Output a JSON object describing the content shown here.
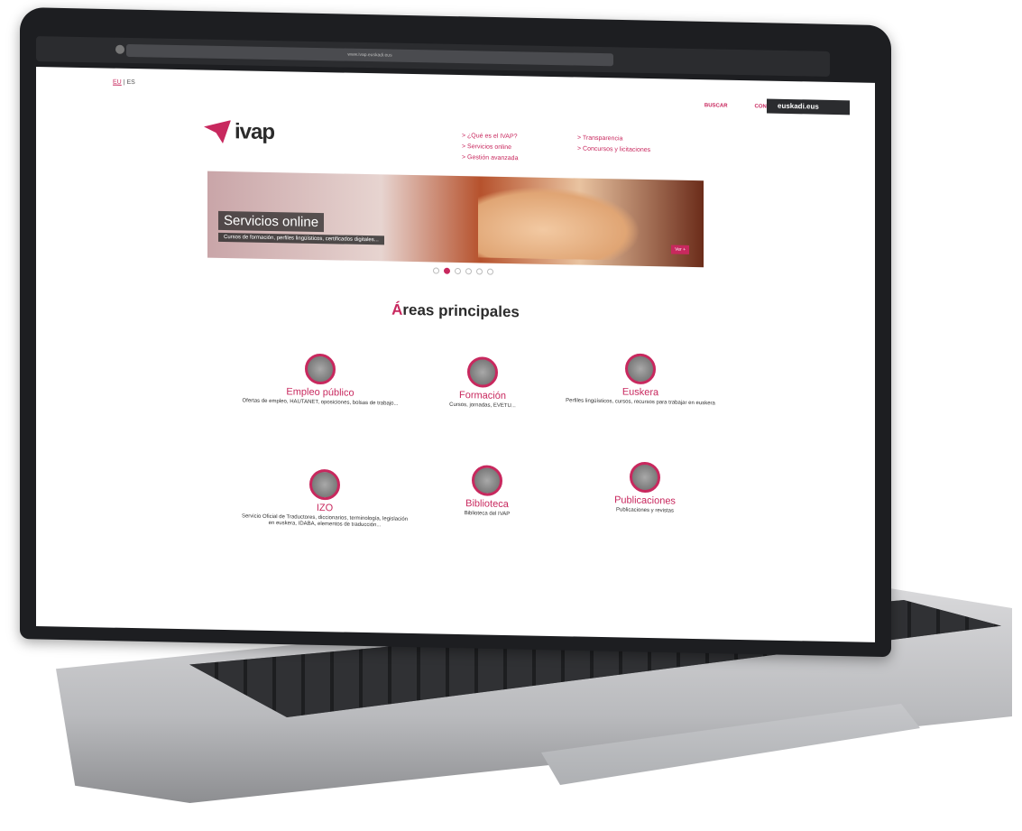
{
  "browser": {
    "url": "www.ivap.euskadi.eus"
  },
  "header": {
    "lang_eu": "EU",
    "lang_sep": "|",
    "lang_es": "ES",
    "nav_search": "BUSCAR",
    "nav_contact": "CONTACTO",
    "euskadi_label": "euskadi.eus"
  },
  "logo": {
    "text": "ivap"
  },
  "links": {
    "col1": [
      "> ¿Qué es el IVAP?",
      "> Servicios online",
      "> Gestión avanzada"
    ],
    "col2": [
      "> Transparencia",
      "> Concursos y licitaciones"
    ]
  },
  "hero": {
    "title": "Servicios online",
    "subtitle": "Cursos de formación, perfiles lingüísticos, certificados digitales...",
    "more": "Ver +"
  },
  "section": {
    "first_letter": "Á",
    "rest": "reas principales"
  },
  "areas": [
    {
      "name": "Empleo público",
      "desc": "Ofertas de empleo, HAUTANET, oposiciones, bolsas de trabajo..."
    },
    {
      "name": "Formación",
      "desc": "Cursos, jornadas, EVETU..."
    },
    {
      "name": "Euskera",
      "desc": "Perfiles lingüísticos, cursos, recursos para trabajar en euskera"
    },
    {
      "name": "IZO",
      "desc": "Servicio Oficial de Traductores, diccionarios, terminología, legislación en euskera, IDABA, elementos de traducción..."
    },
    {
      "name": "Biblioteca",
      "desc": "Biblioteca del IVAP"
    },
    {
      "name": "Publicaciones",
      "desc": "Publicaciones y revistas"
    }
  ]
}
